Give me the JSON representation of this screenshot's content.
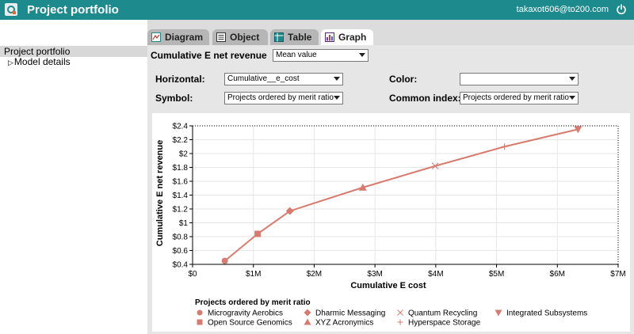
{
  "app": {
    "title": "Project portfolio",
    "user_email": "takaxot606@to200.com"
  },
  "sidebar": {
    "items": [
      {
        "label": "Project portfolio",
        "selected": true
      },
      {
        "label": "Model details",
        "selected": false
      }
    ]
  },
  "tabs": [
    {
      "label": "Diagram",
      "icon": "diagram-icon"
    },
    {
      "label": "Object",
      "icon": "object-icon"
    },
    {
      "label": "Table",
      "icon": "table-icon"
    },
    {
      "label": "Graph",
      "icon": "graph-icon",
      "active": true
    }
  ],
  "controls": {
    "variable_title": "Cumulative E net revenue",
    "variable_select": "Mean value",
    "horizontal_label": "Horizontal:",
    "horizontal_value": "Cumulative__e_cost",
    "color_label": "Color:",
    "color_value": "",
    "symbol_label": "Symbol:",
    "symbol_value": "Projects ordered by merit ratio",
    "common_index_label": "Common index:",
    "common_index_value": "Projects ordered by merit ratio"
  },
  "chart_data": {
    "type": "line",
    "xlabel": "Cumulative  E cost",
    "ylabel": "Cumulative E net revenue",
    "xlim": [
      0,
      7000000
    ],
    "ylim": [
      0.4,
      2.4
    ],
    "x_ticks": [
      "$0",
      "$1M",
      "$2M",
      "$3M",
      "$4M",
      "$5M",
      "$6M",
      "$7M"
    ],
    "y_ticks": [
      "$0.4",
      "$0.6",
      "$0.8",
      "$1",
      "$1.2",
      "$1.4",
      "$1.6",
      "$1.8",
      "$2",
      "$2.2",
      "$2.4"
    ],
    "grid": true,
    "line_color": "#d77b6e",
    "legend_title": "Projects ordered by merit ratio",
    "legend_position": "bottom",
    "points": [
      {
        "name": "Microgravity Aerobics",
        "symbol": "circle",
        "x": 530000,
        "y": 0.45
      },
      {
        "name": "Open Source Genomics",
        "symbol": "square",
        "x": 1070000,
        "y": 0.84
      },
      {
        "name": "Dharmic Messaging",
        "symbol": "diamond",
        "x": 1600000,
        "y": 1.17
      },
      {
        "name": "XYZ Acronymics",
        "symbol": "triangle-up",
        "x": 2800000,
        "y": 1.51
      },
      {
        "name": "Quantum Recycling",
        "symbol": "x",
        "x": 3990000,
        "y": 1.82
      },
      {
        "name": "Hyperspace Storage",
        "symbol": "plus",
        "x": 5130000,
        "y": 2.1
      },
      {
        "name": "Integrated Subsystems",
        "symbol": "triangle-down",
        "x": 6340000,
        "y": 2.35
      }
    ]
  }
}
